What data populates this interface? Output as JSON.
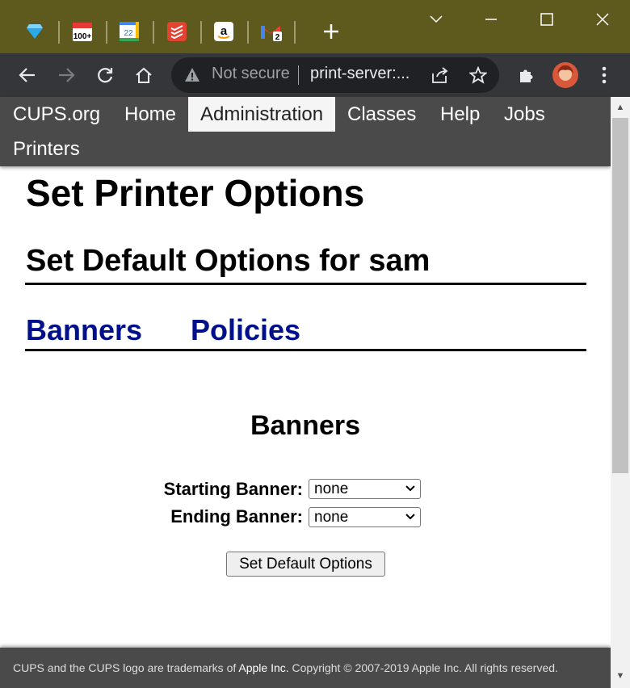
{
  "browser": {
    "tabs": [
      {
        "icon": "diamond-favicon",
        "badge": ""
      },
      {
        "icon": "calendar-100-favicon",
        "badge": "100+"
      },
      {
        "icon": "google-calendar-favicon",
        "badge": "22"
      },
      {
        "icon": "todoist-favicon",
        "badge": ""
      },
      {
        "icon": "amazon-favicon",
        "badge": "a"
      },
      {
        "icon": "gmail-favicon",
        "badge": "2"
      }
    ],
    "omnibox": {
      "security_label": "Not secure",
      "url": "print-server:..."
    }
  },
  "nav": {
    "items": [
      "CUPS.org",
      "Home",
      "Administration",
      "Classes",
      "Help",
      "Jobs",
      "Printers"
    ],
    "active": "Administration"
  },
  "page": {
    "title": "Set Printer Options",
    "subtitle": "Set Default Options for sam",
    "tabs": [
      "Banners",
      "Policies"
    ],
    "section_title": "Banners",
    "fields": [
      {
        "label": "Starting Banner:",
        "value": "none"
      },
      {
        "label": "Ending Banner:",
        "value": "none"
      }
    ],
    "submit_label": "Set Default Options"
  },
  "footer": {
    "prefix": "CUPS and the CUPS logo are trademarks of",
    "company": "Apple Inc.",
    "suffix": "Copyright © 2007-2019 Apple Inc. All rights reserved."
  },
  "colors": {
    "tabstrip": "#5e5a1e",
    "toolbar": "#35363a",
    "cups_nav": "#4a4a4a",
    "link": "#00108a"
  }
}
